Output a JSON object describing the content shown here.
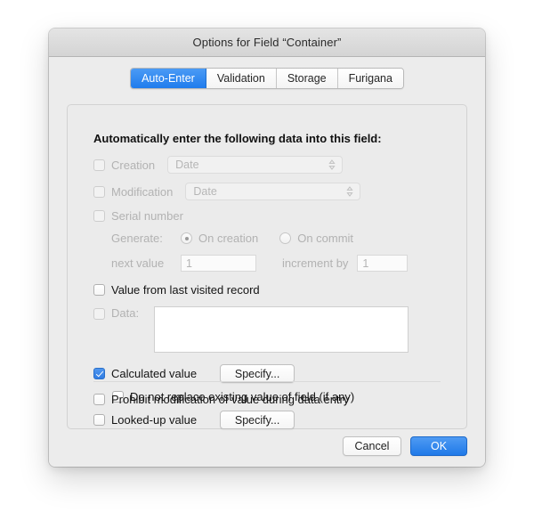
{
  "window": {
    "title": "Options for Field “Container”"
  },
  "tabs": [
    {
      "label": "Auto-Enter",
      "selected": true
    },
    {
      "label": "Validation",
      "selected": false
    },
    {
      "label": "Storage",
      "selected": false
    },
    {
      "label": "Furigana",
      "selected": false
    }
  ],
  "panel": {
    "heading": "Automatically enter the following data into this field:",
    "creation": {
      "label": "Creation",
      "checked": false,
      "enabled": false,
      "popup_value": "Date"
    },
    "modification": {
      "label": "Modification",
      "checked": false,
      "enabled": false,
      "popup_value": "Date"
    },
    "serial_number": {
      "label": "Serial number",
      "checked": false,
      "enabled": false
    },
    "generate": {
      "label": "Generate:",
      "options": [
        {
          "label": "On creation",
          "selected": true
        },
        {
          "label": "On commit",
          "selected": false
        }
      ],
      "next_value_label": "next value",
      "next_value": "1",
      "increment_by_label": "increment by",
      "increment_by": "1"
    },
    "value_from_last_visited": {
      "label": "Value from last visited record",
      "checked": false,
      "enabled": true
    },
    "data": {
      "label": "Data:",
      "checked": false,
      "enabled": false,
      "value": ""
    },
    "calculated_value": {
      "label": "Calculated value",
      "checked": true,
      "enabled": true,
      "specify_label": "Specify..."
    },
    "do_not_replace": {
      "label": "Do not replace existing value of field (if any)",
      "checked": false,
      "enabled": true
    },
    "looked_up_value": {
      "label": "Looked-up value",
      "checked": false,
      "enabled": true,
      "specify_label": "Specify..."
    },
    "prohibit_modification": {
      "label": "Prohibit modification of value during data entry",
      "checked": false,
      "enabled": true
    }
  },
  "footer": {
    "cancel_label": "Cancel",
    "ok_label": "OK"
  },
  "colors": {
    "accent_blue": "#2f7ce4",
    "window_bg": "#ececec",
    "panel_bg": "#ebebeb",
    "disabled_text": "#b2b2b2"
  }
}
